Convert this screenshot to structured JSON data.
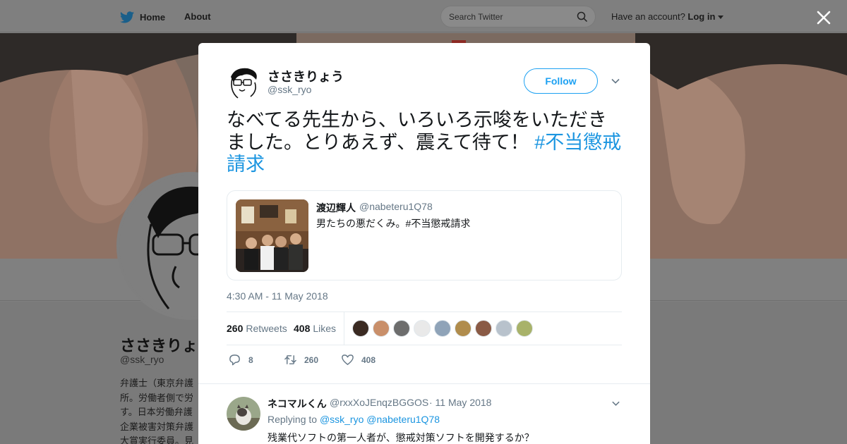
{
  "topbar": {
    "home_label": "Home",
    "about_label": "About",
    "search_placeholder": "Search Twitter",
    "account_prompt": "Have an account?",
    "login_label": "Log in",
    "icons": [
      "twitter-bird-icon",
      "search-icon",
      "caret-down-icon",
      "close-icon"
    ]
  },
  "profile": {
    "name": "ささきりょ",
    "handle": "@ssk_ryo",
    "bio": "弁護士（東京弁護\n所。労働者側で労\nす。日本労働弁護\n企業被害対策弁護\n大賞実行委員。見"
  },
  "tweet": {
    "author_name": "ささきりょう",
    "author_handle": "@ssk_ryo",
    "follow_label": "Follow",
    "text": "なべてる先生から、いろいろ示唆をいただきました。とりあえず、震えて待て！ ",
    "hashtag": "#不当懲戒請求",
    "timestamp": "4:30 AM - 11 May 2018",
    "retweets_count": "260",
    "retweets_label": "Retweets",
    "likes_count": "408",
    "likes_label": "Likes",
    "reply_count": "8",
    "retweet_count": "260",
    "like_count": "408"
  },
  "quoted": {
    "name": "渡辺輝人",
    "handle": "@nabeteru1Q78",
    "text": "男たちの悪だくみ。#不当懲戒請求"
  },
  "likers": [
    {
      "color": "#3a2a22"
    },
    {
      "color": "#c98f6a"
    },
    {
      "color": "#6d6d6d"
    },
    {
      "color": "#e9e9e9"
    },
    {
      "color": "#8fa3b8"
    },
    {
      "color": "#b08c4c"
    },
    {
      "color": "#8a5a45"
    },
    {
      "color": "#b8c2cc"
    },
    {
      "color": "#a8b26a"
    }
  ],
  "reply": {
    "name": "ネコマルくん",
    "handle": "@rxxXoJEnqzBGGOS",
    "date": "· 11 May 2018",
    "replying_prefix": "Replying to",
    "replying_to_1": "@ssk_ryo",
    "replying_to_2": "@nabeteru1Q78",
    "text": "残業代ソフトの第一人者が、懲戒対策ソフトを開発するか？"
  },
  "colors": {
    "accent": "#1da1f2",
    "link": "#1b95e0",
    "muted": "#657786",
    "overlay": "#7f7f7f"
  }
}
